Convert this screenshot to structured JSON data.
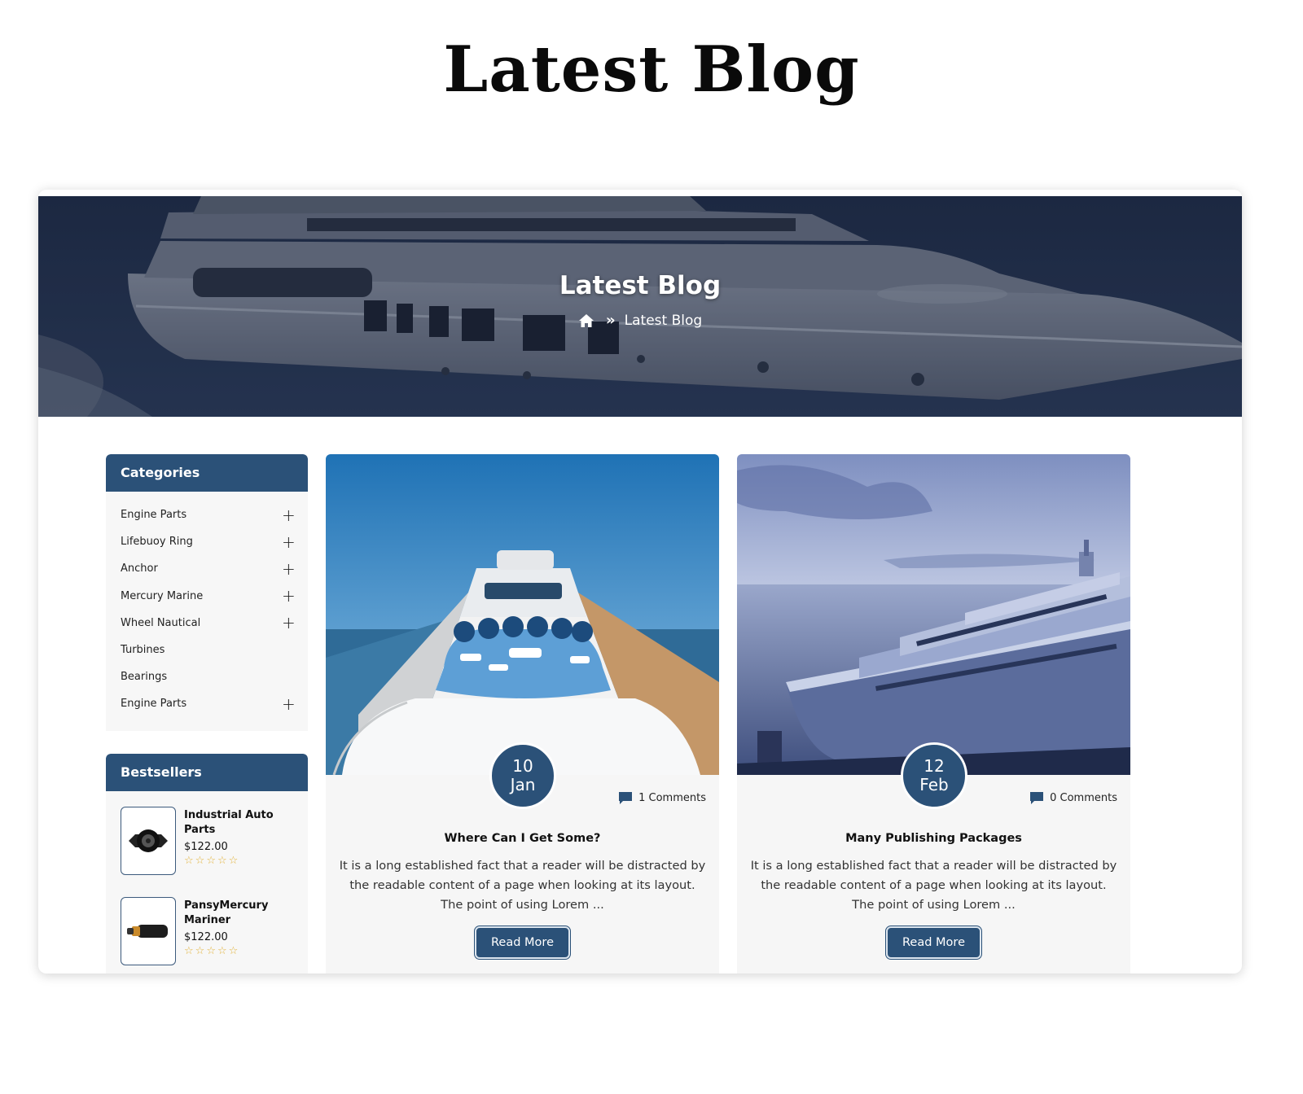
{
  "page": {
    "heading": "Latest Blog"
  },
  "banner": {
    "title": "Latest Blog",
    "breadcrumb": {
      "current": "Latest Blog"
    }
  },
  "categories": {
    "title": "Categories",
    "items": [
      {
        "label": "Engine Parts",
        "expandable": true
      },
      {
        "label": "Lifebuoy Ring",
        "expandable": true
      },
      {
        "label": "Anchor",
        "expandable": true
      },
      {
        "label": "Mercury Marine",
        "expandable": true
      },
      {
        "label": "Wheel Nautical",
        "expandable": true
      },
      {
        "label": "Turbines",
        "expandable": false
      },
      {
        "label": "Bearings",
        "expandable": false
      },
      {
        "label": "Engine Parts",
        "expandable": true
      }
    ]
  },
  "bestsellers": {
    "title": "Bestsellers",
    "items": [
      {
        "name": "Industrial Auto Parts",
        "price": "$122.00",
        "rating": 0
      },
      {
        "name": "PansyMercury Mariner",
        "price": "$122.00",
        "rating": 0
      }
    ]
  },
  "posts": [
    {
      "day": "10",
      "month": "Jan",
      "comments": "1 Comments",
      "title": "Where Can I Get Some?",
      "excerpt": "It is a long established fact that a reader will be distracted by the readable content of a page when looking at its layout. The point of using Lorem ...",
      "cta": "Read More"
    },
    {
      "day": "12",
      "month": "Feb",
      "comments": "0 Comments",
      "title": "Many Publishing Packages",
      "excerpt": "It is a long established fact that a reader will be distracted by the readable content of a page when looking at its layout. The point of using Lorem ...",
      "cta": "Read More"
    }
  ],
  "colors": {
    "primary": "#2b5178",
    "star": "#e2b33b",
    "panel": "#f7f7f7"
  },
  "icons": {
    "home": "home-icon",
    "separator": "double-chevron-right-icon",
    "plus": "plus-icon",
    "comment": "comment-icon",
    "star": "star-icon"
  }
}
